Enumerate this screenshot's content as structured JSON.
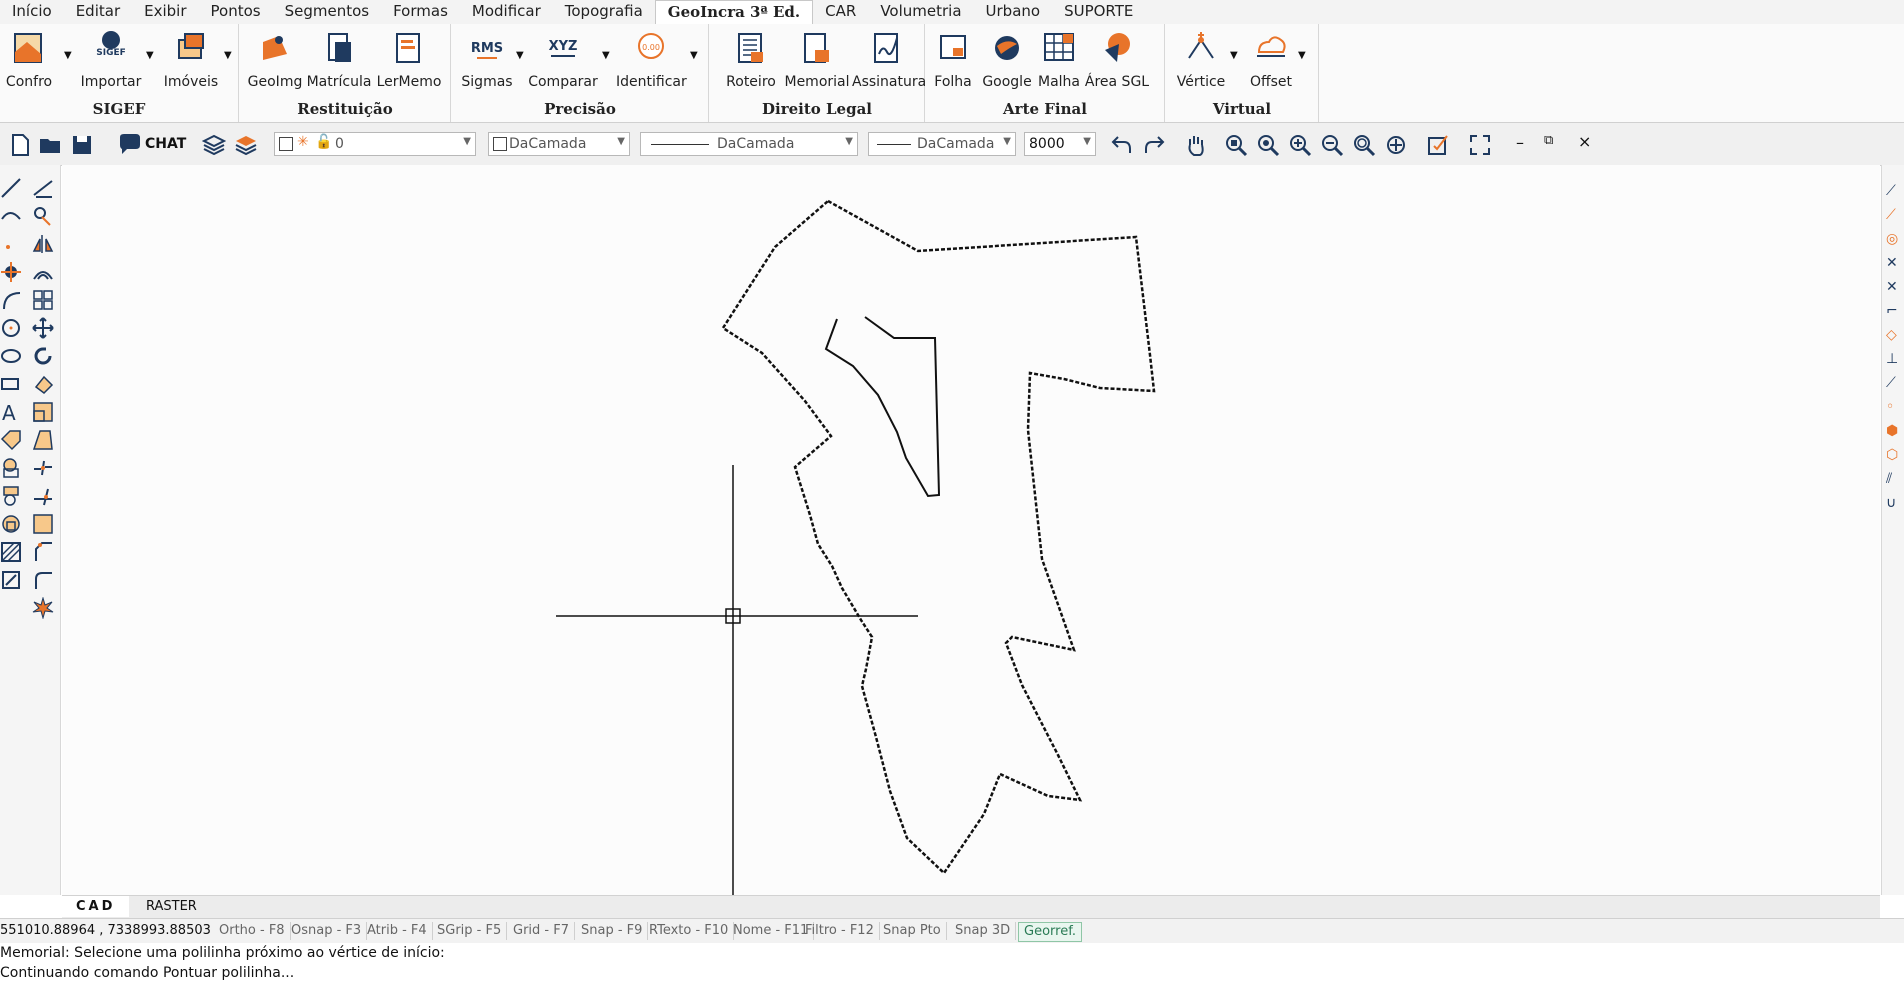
{
  "menu": {
    "items": [
      "Início",
      "Editar",
      "Exibir",
      "Pontos",
      "Segmentos",
      "Formas",
      "Modificar",
      "Topografia",
      "GeoIncra 3ª Ed.",
      "CAR",
      "Volumetria",
      "Urbano",
      "SUPORTE"
    ],
    "active_index": 8
  },
  "ribbon": {
    "groups": [
      {
        "title": "SIGEF",
        "buttons": [
          "Confro",
          "Importar",
          "Imóveis"
        ]
      },
      {
        "title": "Restituição",
        "buttons": [
          "GeoImg",
          "Matrícula",
          "LerMemo"
        ]
      },
      {
        "title": "Precisão",
        "buttons": [
          "Sigmas",
          "Comparar",
          "Identificar"
        ]
      },
      {
        "title": "Direito Legal",
        "buttons": [
          "Roteiro",
          "Memorial",
          "Assinatura"
        ]
      },
      {
        "title": "Arte Final",
        "buttons": [
          "Folha",
          "Google",
          "Malha",
          "Área SGL"
        ]
      },
      {
        "title": "Virtual",
        "buttons": [
          "Vértice",
          "Offset"
        ]
      }
    ],
    "sigef_icon_text": "SIGEF",
    "rms_icon_text": "RMS",
    "xyz_icon_text": "XYZ",
    "identify_icon_text": "0.00"
  },
  "toolbar": {
    "chat_label": "CHAT",
    "layer_value": "0",
    "color_value": "DaCamada",
    "linetype_value": "DaCamada",
    "lineweight_value": "DaCamada",
    "scale_value": "8000"
  },
  "tabs": [
    "CAD",
    "RASTER"
  ],
  "status": {
    "coords": "551010.88964 , 7338993.88503",
    "buttons": [
      "Ortho - F8",
      "Osnap - F3",
      "Atrib - F4",
      "SGrip - F5",
      "Grid - F7",
      "Snap - F9",
      "RTexto - F10",
      "Nome - F11",
      "Filtro - F12",
      "Snap Pto",
      "Snap 3D",
      "Georref."
    ],
    "active_button": "Georref."
  },
  "command": {
    "line1": "Memorial: Selecione uma polilinha próximo ao vértice de início:",
    "line2": "Continuando comando Pontuar polilinha..."
  },
  "colors": {
    "accent_orange": "#e8742a",
    "icon_navy": "#1f3a5f",
    "georref_green": "#2a7b55"
  }
}
